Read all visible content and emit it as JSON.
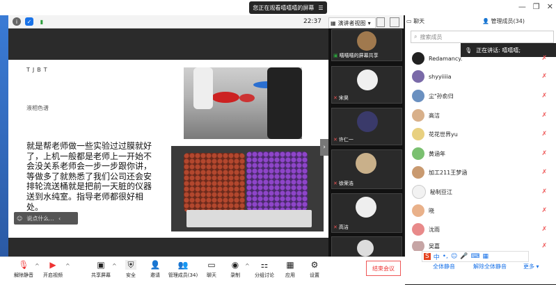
{
  "banner": {
    "text": "您正在观看嘻嘻嘻的屏幕",
    "icon": "list-icon"
  },
  "window": {
    "minimize": "—",
    "restore": "❐",
    "close": "✕"
  },
  "meeting_bar": {
    "time": "22:37",
    "view_mode": "演讲者视图"
  },
  "slide": {
    "tag": "TJBT",
    "subtitle": "液相色谱",
    "body": "就是帮老师做一些实验过过膜就好了，上机一般都是老师上一开始不会没关系老师会一步一步跟你讲，等做多了就熟悉了我们公司还会安排轮流送桶就是把前一天脏的仪器送到水纯室。指导老师都很好相处。"
  },
  "chat_input": {
    "placeholder": "说点什么..."
  },
  "thumbnails": [
    {
      "label": "嘻嘻嘻的屏幕共享"
    },
    {
      "label": "宋昊"
    },
    {
      "label": "许仁一"
    },
    {
      "label": "徐荣浩"
    },
    {
      "label": "高洁"
    },
    {
      "label": ""
    }
  ],
  "right_panel": {
    "chat_tab": "聊天",
    "members_tab": "管理成员(34)",
    "search_placeholder": "搜索成员",
    "speaking": "正在讲话: 嘻嘻嘻;",
    "members": [
      {
        "name": "Redamancy."
      },
      {
        "name": "shyyiiiia"
      },
      {
        "name": "尘\"孙俞归"
      },
      {
        "name": "高洁"
      },
      {
        "name": "花花世界yu"
      },
      {
        "name": "黄涵年"
      },
      {
        "name": "加工211王梦涵"
      },
      {
        "name": "秘制豆江"
      },
      {
        "name": "晓"
      },
      {
        "name": "沈雨"
      },
      {
        "name": "吴嘉"
      }
    ],
    "mute_all": "全体静音",
    "unmute_all": "解除全体静音",
    "more": "更多"
  },
  "toolbar": {
    "unmute": "解除静音",
    "start_video": "开启视频",
    "share_screen": "共享屏幕",
    "security": "安全",
    "invite": "邀请",
    "manage_members": "管理成员(34)",
    "chat": "聊天",
    "record": "录制",
    "breakout": "分组讨论",
    "apps": "应用",
    "settings": "设置",
    "end_meeting": "结束会议"
  },
  "colors": {
    "accent": "#1a73e8",
    "danger": "#e53935"
  }
}
